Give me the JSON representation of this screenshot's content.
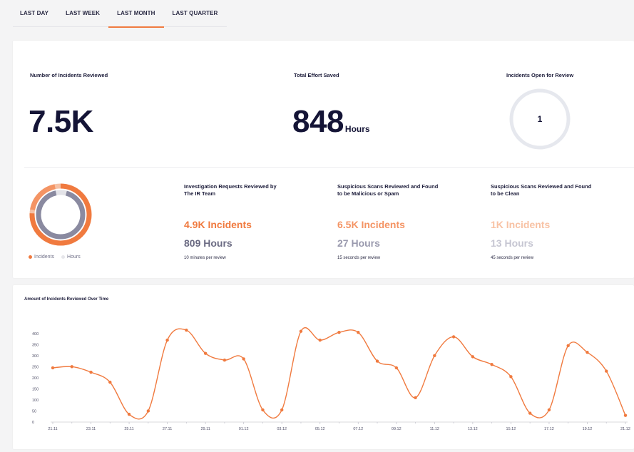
{
  "tabs": [
    {
      "label": "LAST DAY",
      "active": false
    },
    {
      "label": "LAST WEEK",
      "active": false
    },
    {
      "label": "LAST MONTH",
      "active": true
    },
    {
      "label": "LAST QUARTER",
      "active": false
    }
  ],
  "summary": {
    "incidents_reviewed": {
      "label": "Number of Incidents Reviewed",
      "value": "7.5K"
    },
    "effort_saved": {
      "label": "Total Effort Saved",
      "value": "848",
      "unit": "Hours"
    },
    "open_for_review": {
      "label": "Incidents Open for Review",
      "value": "1"
    }
  },
  "donut": {
    "legend": [
      {
        "label": "Incidents",
        "color": "#f07a3f"
      },
      {
        "label": "Hours",
        "color": "#e6e6ea"
      }
    ]
  },
  "breakdown": [
    {
      "title": "Investigation Requests Reviewed by The IR Team",
      "incidents": "4.9K Incidents",
      "hours": "809 Hours",
      "note": "10 minutes per review",
      "inc_color": "#f07a3f",
      "hrs_color": "#6a6a82"
    },
    {
      "title": "Suspicious Scans Reviewed and Found to be Malicious or Spam",
      "incidents": "6.5K Incidents",
      "hours": "27 Hours",
      "note": "15 seconds per review",
      "inc_color": "#f49464",
      "hrs_color": "#9a9aae"
    },
    {
      "title": "Suspicious Scans Reviewed and Found to be Clean",
      "incidents": "1K Incidents",
      "hours": "13 Hours",
      "note": "45 seconds per review",
      "inc_color": "#f8c2a4",
      "hrs_color": "#c6c6d2"
    }
  ],
  "colors": {
    "accent": "#f07a3f",
    "navy": "#141436",
    "ring": "#e6e8ee"
  },
  "chart_data": {
    "type": "line",
    "title": "Amount of Incidents Reviewed Over Time",
    "x": [
      "21.11",
      "22.11",
      "23.11",
      "24.11",
      "25.11",
      "26.11",
      "27.11",
      "28.11",
      "29.11",
      "30.11",
      "01.12",
      "02.12",
      "03.12",
      "04.12",
      "05.12",
      "06.12",
      "07.12",
      "08.12",
      "09.12",
      "10.12",
      "11.12",
      "12.12",
      "13.12",
      "14.12",
      "15.12",
      "16.12",
      "17.12",
      "18.12",
      "19.12",
      "20.12",
      "21.12"
    ],
    "x_tick_labels": [
      "21.11",
      "23.11",
      "25.11",
      "27.11",
      "29.11",
      "01.12",
      "03.12",
      "05.12",
      "07.12",
      "09.12",
      "11.12",
      "13.12",
      "15.12",
      "17.12",
      "19.12",
      "21.12"
    ],
    "series": [
      {
        "values": [
          245,
          250,
          225,
          180,
          35,
          50,
          370,
          415,
          310,
          280,
          285,
          55,
          55,
          410,
          370,
          405,
          405,
          275,
          245,
          110,
          300,
          385,
          295,
          260,
          205,
          40,
          55,
          345,
          315,
          230,
          30
        ]
      }
    ],
    "ylim": [
      0,
      425
    ],
    "y_ticks": [
      0,
      50,
      100,
      150,
      200,
      250,
      300,
      350,
      400
    ],
    "grid": false
  }
}
